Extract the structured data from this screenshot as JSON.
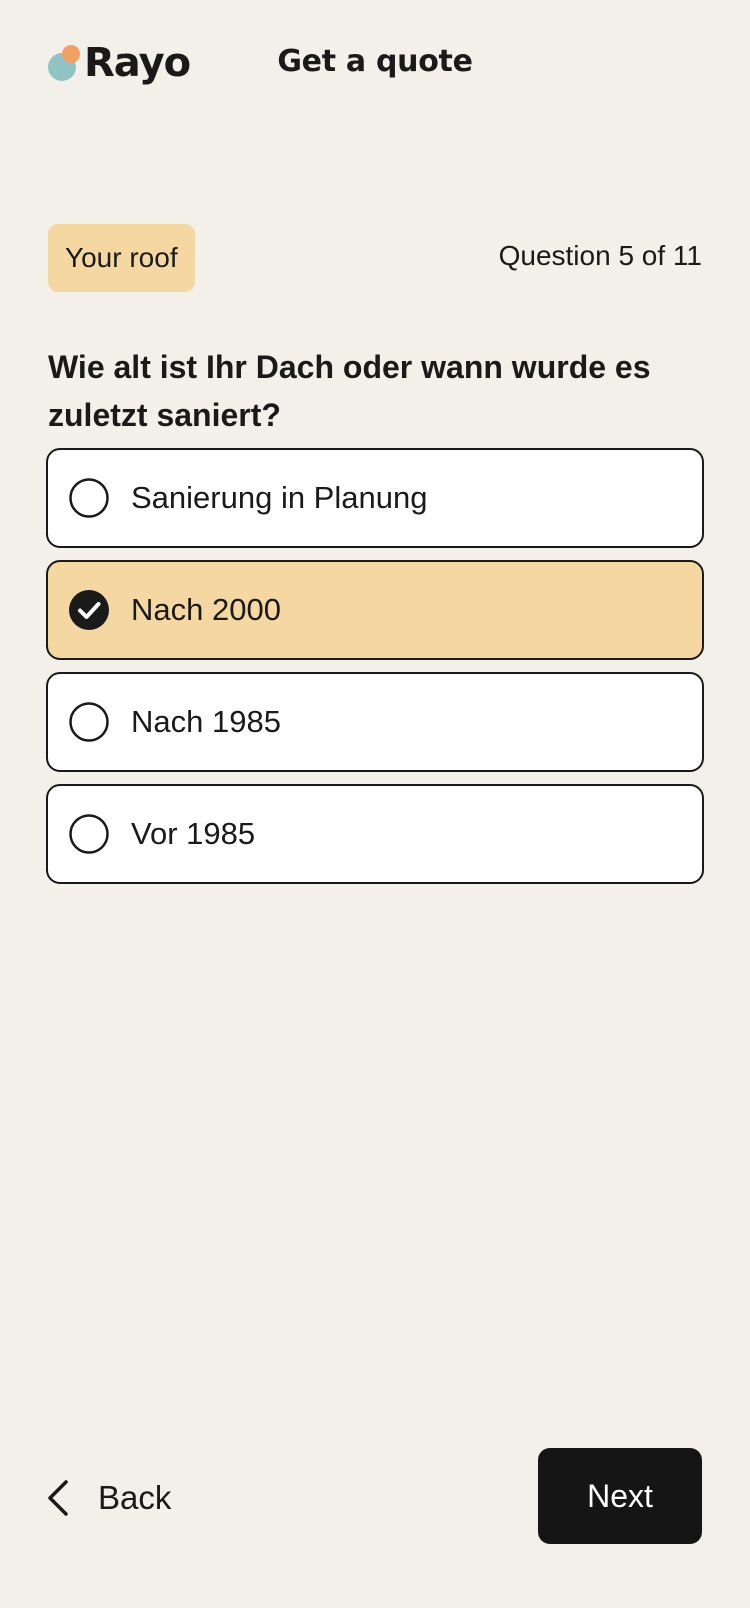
{
  "header": {
    "brand": "Rayo",
    "title": "Get a quote"
  },
  "progress": {
    "section": "Your roof",
    "counter": "Question 5 of 11",
    "current": 5,
    "total": 11
  },
  "question": {
    "text": "Wie alt ist Ihr Dach oder wann wurde es zuletzt saniert?",
    "options": [
      {
        "label": "Sanierung in Planung",
        "selected": false
      },
      {
        "label": "Nach 2000",
        "selected": true
      },
      {
        "label": "Nach 1985",
        "selected": false
      },
      {
        "label": "Vor 1985",
        "selected": false
      }
    ]
  },
  "footer": {
    "back_label": "Back",
    "next_label": "Next"
  },
  "colors": {
    "background": "#f3f0e9",
    "accent": "#f5d8a1",
    "logo_teal": "#8fc3c4",
    "logo_orange": "#f3a065",
    "primary_button": "#151515"
  },
  "icons": {
    "back": "chevron-left-icon",
    "selected": "check-circle-icon",
    "unselected": "radio-empty-icon"
  }
}
